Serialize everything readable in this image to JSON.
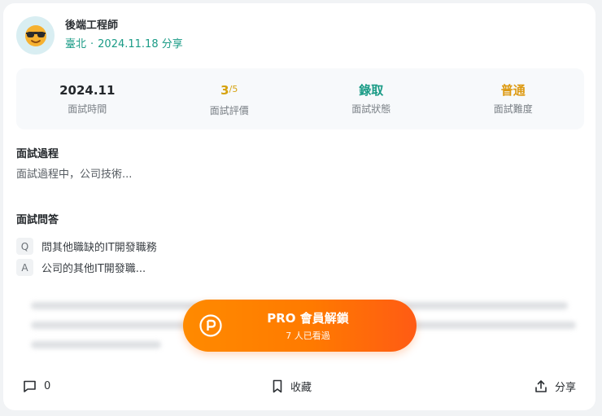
{
  "author": {
    "name": "後端工程師",
    "location": "臺北",
    "separator": "·",
    "date_shared": "2024.11.18 分享"
  },
  "stats": [
    {
      "value": "2024.11",
      "label": "面試時間"
    },
    {
      "value_num": "3",
      "value_den": "/5",
      "label": "面試評價"
    },
    {
      "value": "錄取",
      "label": "面試狀態"
    },
    {
      "value": "普通",
      "label": "面試難度"
    }
  ],
  "process": {
    "title": "面試過程",
    "text": "面試過程中，公司技術..."
  },
  "qa": {
    "title": "面試問答",
    "q_badge": "Q",
    "question": "問其他職缺的IT開發職務",
    "a_badge": "A",
    "answer": "公司的其他IT開發職..."
  },
  "pro": {
    "title": "PRO 會員解鎖",
    "subtitle": "7 人已看過",
    "icon": "pro-coin-icon"
  },
  "footer": {
    "comments_icon": "comment-icon",
    "comments_count": "0",
    "save_icon": "bookmark-icon",
    "save_label": "收藏",
    "share_icon": "share-icon",
    "share_label": "分享"
  },
  "colors": {
    "accent_green": "#1a9b86",
    "rating_gold": "#d6a20e",
    "difficulty_orange": "#dd9a12",
    "pro_gradient_start": "#ff8a00",
    "pro_gradient_end": "#ff5b14"
  }
}
